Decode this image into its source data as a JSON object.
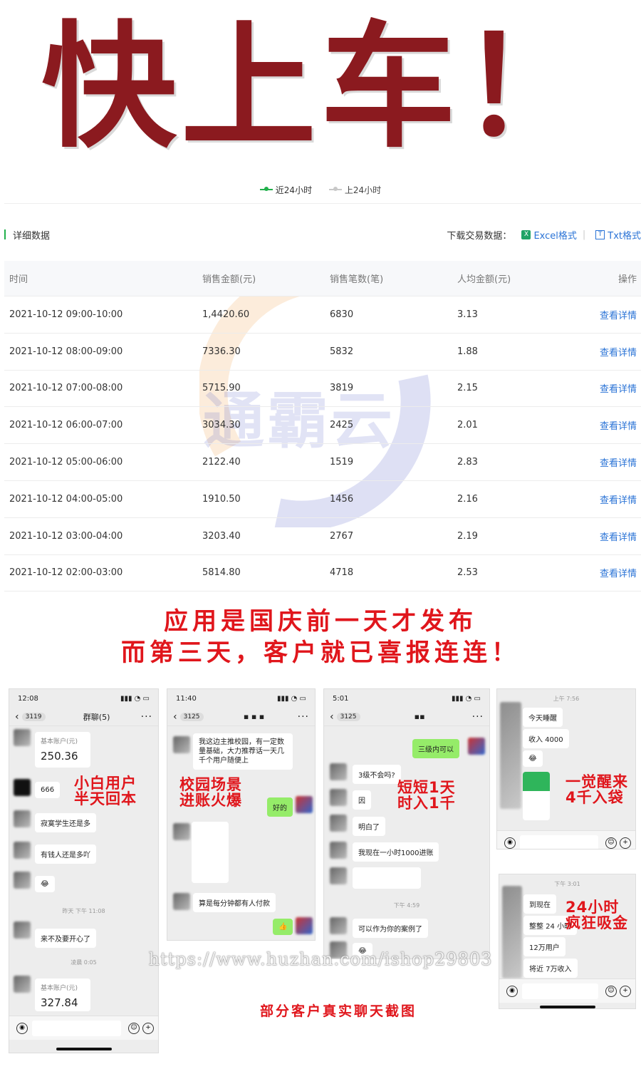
{
  "headline": "快上车！",
  "legend": {
    "current": "近24小时",
    "previous": "上24小时"
  },
  "section": {
    "title": "详细数据",
    "download_label": "下载交易数据：",
    "excel": "Excel格式",
    "txt": "Txt格式",
    "separator": "|"
  },
  "table": {
    "headers": [
      "时间",
      "销售金额(元)",
      "销售笔数(笔)",
      "人均金额(元)",
      "操作"
    ],
    "rows": [
      {
        "time": "2021-10-12 09:00-10:00",
        "amount": "1,4420.60",
        "count": "6830",
        "avg": "3.13",
        "action": "查看详情"
      },
      {
        "time": "2021-10-12 08:00-09:00",
        "amount": "7336.30",
        "count": "5832",
        "avg": "1.88",
        "action": "查看详情"
      },
      {
        "time": "2021-10-12 07:00-08:00",
        "amount": "5715.90",
        "count": "3819",
        "avg": "2.15",
        "action": "查看详情"
      },
      {
        "time": "2021-10-12 06:00-07:00",
        "amount": "3034.30",
        "count": "2425",
        "avg": "2.01",
        "action": "查看详情"
      },
      {
        "time": "2021-10-12 05:00-06:00",
        "amount": "2122.40",
        "count": "1519",
        "avg": "2.83",
        "action": "查看详情"
      },
      {
        "time": "2021-10-12 04:00-05:00",
        "amount": "1910.50",
        "count": "1456",
        "avg": "2.16",
        "action": "查看详情"
      },
      {
        "time": "2021-10-12 03:00-04:00",
        "amount": "3203.40",
        "count": "2767",
        "avg": "2.19",
        "action": "查看详情"
      },
      {
        "time": "2021-10-12 02:00-03:00",
        "amount": "5814.80",
        "count": "4718",
        "avg": "2.53",
        "action": "查看详情"
      }
    ]
  },
  "watermark": "通霸云",
  "promo": {
    "line1": "应用是国庆前一天才发布",
    "line2": "而第三天，客户就已喜报连连！"
  },
  "shot1": {
    "time": "12:08",
    "badge": "3119",
    "title": "群聊(5)",
    "account_label": "基本账户(元)",
    "amount": "250.36",
    "msg1": "666",
    "msg2": "寂寞学生还是多",
    "msg3": "有钱人还是多吖",
    "time_mark": "昨天 下午 11:08",
    "msg4": "来不及要开心了",
    "time_mark2": "凌晨 0:05",
    "account_label2": "基本账户(元)",
    "amount2": "327.84",
    "caption_line1": "小白用户",
    "caption_line2": "半天回本"
  },
  "shot2": {
    "time": "11:40",
    "badge": "3125",
    "msg1": "我这边主推校园，有一定数量基础，大力推荐话一天几千个用户随便上",
    "reply": "好的",
    "msg2": "算是每分钟都有人付款",
    "caption_line1": "校园场景",
    "caption_line2": "进账火爆"
  },
  "shot3": {
    "time": "5:01",
    "badge": "3125",
    "green1": "三级内可以",
    "msg1": "3级不会吗?",
    "msg2": "因",
    "msg3": "明白了",
    "msg4": "我现在一小时1000进账",
    "time_mark": "下午 4:59",
    "msg5": "可以作为你的案例了",
    "caption_line1": "短短1天",
    "caption_line2": "时入1千"
  },
  "shot4": {
    "time_mark": "上午 7:56",
    "msg1": "今天睡醒",
    "msg2": "收入 4000",
    "caption_line1": "一觉醒来",
    "caption_line2": "4千入袋"
  },
  "shot5": {
    "time_mark": "下午 3:01",
    "msg1": "到现在",
    "msg2": "整整 24 小时",
    "msg3": "12万用户",
    "msg4": "将近 7万收入",
    "caption_line1": "24小时",
    "caption_line2": "疯狂吸金"
  },
  "link_watermark": "https://www.huzhan.com/ishop29803",
  "footer_caption": "部分客户真实聊天截图",
  "colors": {
    "headline": "#8b1a1f",
    "accent_red": "#e0161c",
    "link_blue": "#2a73d6",
    "green": "#21b04b"
  }
}
